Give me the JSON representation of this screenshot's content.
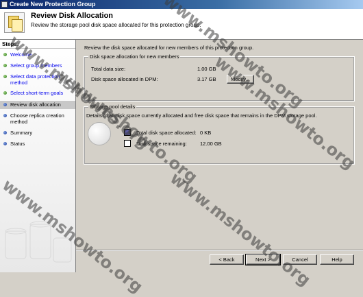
{
  "window": {
    "title": "Create New Protection Group"
  },
  "header": {
    "title": "Review Disk Allocation",
    "subtitle": "Review the storage pool disk space allocated for this protection group."
  },
  "sidebar": {
    "label": "Steps:",
    "items": [
      {
        "label": "Welcome",
        "state": "link"
      },
      {
        "label": "Select group members",
        "state": "link"
      },
      {
        "label": "Select data protection method",
        "state": "link"
      },
      {
        "label": "Select short-term goals",
        "state": "link"
      },
      {
        "label": "Review disk allocation",
        "state": "current"
      },
      {
        "label": "Choose replica creation method",
        "state": "pending"
      },
      {
        "label": "Summary",
        "state": "pending"
      },
      {
        "label": "Status",
        "state": "pending"
      }
    ]
  },
  "main": {
    "intro": "Review the disk space allocated for new members of this protection group.",
    "new_members": {
      "title": "Disk space allocation for new members",
      "total_label": "Total data size:",
      "total_value": "1.00 GB",
      "allocated_label": "Disk space allocated in DPM:",
      "allocated_value": "3.17 GB",
      "modify_button": "Modify..."
    },
    "storage_pool": {
      "title": "Storage pool details",
      "description": "Details of all disk space currently allocated and free disk space that remains in the DPM storage pool.",
      "allocated_label": "Total disk space allocated:",
      "allocated_value": "0 KB",
      "remaining_label": "Disk space remaining:",
      "remaining_value": "12.00 GB",
      "colors": {
        "allocated": "#5a5aa0",
        "remaining": "#ffffff"
      }
    }
  },
  "footer": {
    "back": "< Back",
    "next": "Next >",
    "cancel": "Cancel",
    "help": "Help"
  },
  "watermark": "www.mshowto.org"
}
